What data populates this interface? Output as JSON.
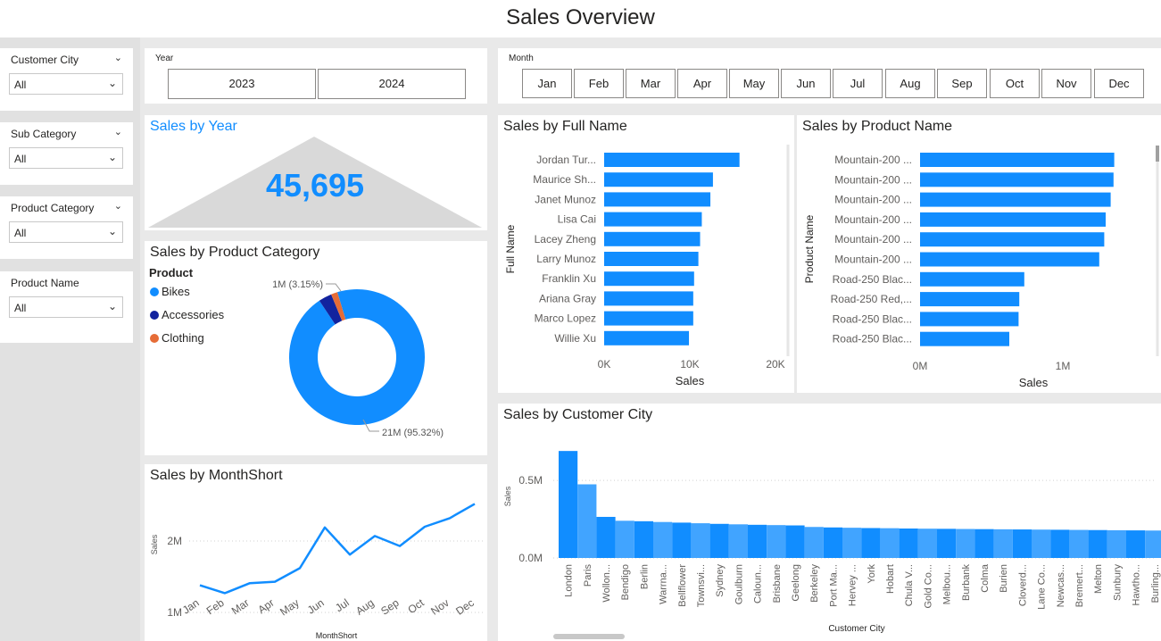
{
  "page_title": "Sales Overview",
  "slicers": [
    {
      "label": "Customer City",
      "value": "All"
    },
    {
      "label": "Sub Category",
      "value": "All"
    },
    {
      "label": "Product Category",
      "value": "All"
    },
    {
      "label": "Product Name",
      "value": "All"
    }
  ],
  "year_tile": {
    "label": "Year",
    "options": [
      "2023",
      "2024"
    ]
  },
  "month_tile": {
    "label": "Month",
    "options": [
      "Jan",
      "Feb",
      "Mar",
      "Apr",
      "May",
      "Jun",
      "Jul",
      "Aug",
      "Sep",
      "Oct",
      "Nov",
      "Dec"
    ]
  },
  "kpi": {
    "title": "Sales by Year",
    "value": "45,695"
  },
  "colors": {
    "accent": "#118dff",
    "dark_blue": "#12239e",
    "orange": "#e66c37",
    "light_blue": "#41a4ff",
    "kpi_bg": "#d9d9d9",
    "kpi_title": "#118dff"
  },
  "icons": {
    "dropdown": "chevron-down-icon"
  },
  "chart_data": [
    {
      "id": "donut",
      "type": "pie",
      "title": "Sales by Product Category",
      "legend_title": "Product",
      "categories": [
        "Bikes",
        "Accessories",
        "Clothing"
      ],
      "values": [
        95.32,
        3.15,
        1.53
      ],
      "slice_labels": [
        "21M (95.32%)",
        "1M (3.15%)",
        ""
      ],
      "legend": "left"
    },
    {
      "id": "fullname",
      "type": "bar",
      "title": "Sales by Full Name",
      "xlabel": "Sales",
      "ylabel": "Full Name",
      "categories": [
        "Jordan Tur...",
        "Maurice Sh...",
        "Janet Munoz",
        "Lisa Cai",
        "Lacey Zheng",
        "Larry Munoz",
        "Franklin Xu",
        "Ariana Gray",
        "Marco Lopez",
        "Willie Xu"
      ],
      "values": [
        15800,
        12700,
        12400,
        11400,
        11200,
        11000,
        10500,
        10400,
        10400,
        9900
      ],
      "xlim": [
        0,
        20000
      ],
      "ticks": [
        0,
        10000,
        20000
      ],
      "tick_labels": [
        "0K",
        "10K",
        "20K"
      ]
    },
    {
      "id": "product",
      "type": "bar",
      "title": "Sales by Product Name",
      "xlabel": "Sales",
      "ylabel": "Product Name",
      "categories": [
        "Mountain-200 ...",
        "Mountain-200 ...",
        "Mountain-200 ...",
        "Mountain-200 ...",
        "Mountain-200 ...",
        "Mountain-200 ...",
        "Road-250 Blac...",
        "Road-250 Red,...",
        "Road-250 Blac...",
        "Road-250 Blac..."
      ],
      "values": [
        1360000,
        1355000,
        1335000,
        1300000,
        1290000,
        1255000,
        730000,
        695000,
        690000,
        625000
      ],
      "xlim": [
        0,
        1500000
      ],
      "ticks": [
        0,
        1000000
      ],
      "tick_labels": [
        "0M",
        "1M"
      ]
    },
    {
      "id": "month",
      "type": "line",
      "title": "Sales by MonthShort",
      "xlabel": "MonthShort",
      "ylabel": "Sales",
      "categories": [
        "Jan",
        "Feb",
        "Mar",
        "Apr",
        "May",
        "Jun",
        "Jul",
        "Aug",
        "Sep",
        "Oct",
        "Nov",
        "Dec"
      ],
      "values": [
        1380000,
        1270000,
        1410000,
        1430000,
        1620000,
        2190000,
        1810000,
        2070000,
        1930000,
        2200000,
        2320000,
        2520000
      ],
      "ylim": [
        950000,
        2800000
      ],
      "ticks": [
        1000000,
        2000000
      ],
      "tick_labels": [
        "1M",
        "2M"
      ],
      "grid": true
    },
    {
      "id": "city",
      "type": "area",
      "title": "Sales by Customer City",
      "xlabel": "Customer City",
      "ylabel": "Sales",
      "categories": [
        "London",
        "Paris",
        "Wollon...",
        "Bendigo",
        "Berlin",
        "Warrna...",
        "Bellflower",
        "Townsvi...",
        "Sydney",
        "Goulburn",
        "Caloun...",
        "Brisbane",
        "Geelong",
        "Berkeley",
        "Port Ma...",
        "Hervey ...",
        "York",
        "Hobart",
        "Chula V...",
        "Gold Co...",
        "Melbou...",
        "Burbank",
        "Colma",
        "Burien",
        "Cloverd...",
        "Lane Co...",
        "Newcas...",
        "Bremert...",
        "Melton",
        "Sunbury",
        "Hawtho...",
        "Burling..."
      ],
      "values": [
        690000,
        475000,
        265000,
        240000,
        237000,
        232000,
        228000,
        224000,
        220000,
        217000,
        214000,
        212000,
        210000,
        200000,
        197000,
        195000,
        193000,
        192000,
        190000,
        189000,
        188000,
        187000,
        186000,
        185000,
        184000,
        183000,
        182000,
        181000,
        180000,
        179000,
        178000,
        177000
      ],
      "ylim": [
        0,
        760000
      ],
      "ticks": [
        0,
        500000
      ],
      "tick_labels": [
        "0.0M",
        "0.5M"
      ],
      "grid": true
    }
  ]
}
